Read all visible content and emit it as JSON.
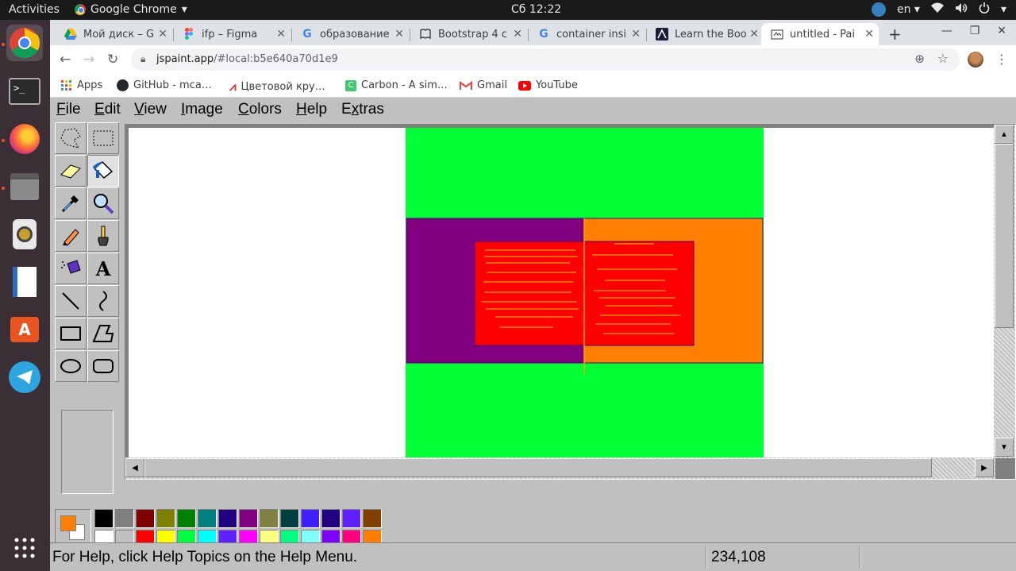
{
  "system": {
    "activities": "Activities",
    "app_name": "Google Chrome",
    "clock": "Сб 12:22",
    "keyboard_layout": "en"
  },
  "browser": {
    "tabs": [
      {
        "title": "Мой диск – G"
      },
      {
        "title": "ifp – Figma"
      },
      {
        "title": "образование"
      },
      {
        "title": "Bootstrap 4 c"
      },
      {
        "title": "container insi"
      },
      {
        "title": "Learn the Boo"
      },
      {
        "title": "untitled - Pai"
      }
    ],
    "url_host": "jspaint.app",
    "url_path": "/#local:b5e640a70d1e9",
    "bookmarks": [
      "Apps",
      "GitHub - mca…",
      "Цветовой кру…",
      "Carbon - A sim…",
      "Gmail",
      "YouTube"
    ]
  },
  "paint": {
    "menu": [
      "File",
      "Edit",
      "View",
      "Image",
      "Colors",
      "Help",
      "Extras"
    ],
    "tools": [
      "free-form-select",
      "rectangle-select",
      "eraser",
      "fill",
      "pick-color",
      "magnifier",
      "pencil",
      "brush",
      "airbrush",
      "text",
      "line",
      "curve",
      "rectangle",
      "polygon",
      "ellipse",
      "rounded-rectangle"
    ],
    "selected_tool": "fill",
    "foreground_color": "#ff8000",
    "background_color": "#ffffff",
    "palette_top": [
      "#000000",
      "#808080",
      "#800000",
      "#808000",
      "#008000",
      "#008080",
      "#200080",
      "#800080",
      "#808040",
      "#004040",
      "#4020ff",
      "#200080",
      "#6020ff",
      "#804000"
    ],
    "palette_bottom": [
      "#ffffff",
      "#c0c0c0",
      "#ff0000",
      "#ffff00",
      "#00ff40",
      "#00ffff",
      "#6020ff",
      "#ff00ff",
      "#ffff80",
      "#00ff80",
      "#80ffff",
      "#8000ff",
      "#ff0080",
      "#ff8000"
    ],
    "status_help": "For Help, click Help Topics on the Help Menu.",
    "status_coords": "234,108",
    "canvas_colors": {
      "background": "#00ff33",
      "left_panel": "#800080",
      "right_panel": "#ff7f00",
      "pages": "#ff0000",
      "lines": "#ffa500",
      "border": "#4b0082"
    }
  }
}
